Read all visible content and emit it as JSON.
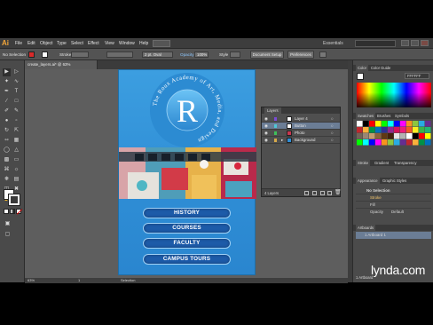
{
  "app": {
    "logo": "Ai",
    "workspace": "Essentials",
    "search_placeholder": ""
  },
  "menu": [
    "File",
    "Edit",
    "Object",
    "Type",
    "Select",
    "Effect",
    "View",
    "Window",
    "Help"
  ],
  "controlbar": {
    "selection": "No Selection",
    "stroke_label": "Stroke",
    "stroke_value": "",
    "profile_label": "2 pt. Oval",
    "opacity_label": "Opacity",
    "opacity_value": "100%",
    "style_label": "Style",
    "document_setup": "Document Setup",
    "preferences": "Preferences"
  },
  "document": {
    "tab_title": "create_layers.ai* @ 63% (RGB/Preview)"
  },
  "artboard": {
    "logo_letter": "R",
    "ring_text": "The Roux Academy of Art, Media, and Design",
    "buttons": [
      "HISTORY",
      "COURSES",
      "FACULTY",
      "CAMPUS TOURS"
    ]
  },
  "layers_panel": {
    "title": "Layers",
    "layers": [
      "Layer 4",
      "Button",
      "Photo",
      "Background"
    ],
    "count": "4 Layers"
  },
  "color_panel": {
    "tab1": "Color",
    "tab2": "Color Guide",
    "hex": "FFFFFF"
  },
  "swatches_panel": {
    "tabs": [
      "Swatches",
      "Brushes",
      "Symbols"
    ]
  },
  "stroke_panel": {
    "tabs": [
      "Stroke",
      "Gradient",
      "Transparency"
    ]
  },
  "appearance_panel": {
    "tabs": [
      "Appearance",
      "Graphic Styles"
    ],
    "selection": "No Selection",
    "rows": [
      "Stroke",
      "Fill",
      "Opacity"
    ],
    "opacity_value": "Default"
  },
  "artboards_panel": {
    "title": "Artboards",
    "item": "1  Artboard 1",
    "footer": "1 Artboard"
  },
  "status": {
    "zoom": "63%",
    "tool": "Selection",
    "page": "1"
  },
  "watermark": "lynda.com",
  "colors": {
    "accent_blue": "#2f8ed6",
    "button_blue": "#1d5ba8",
    "ai_orange": "#f3a63a"
  }
}
